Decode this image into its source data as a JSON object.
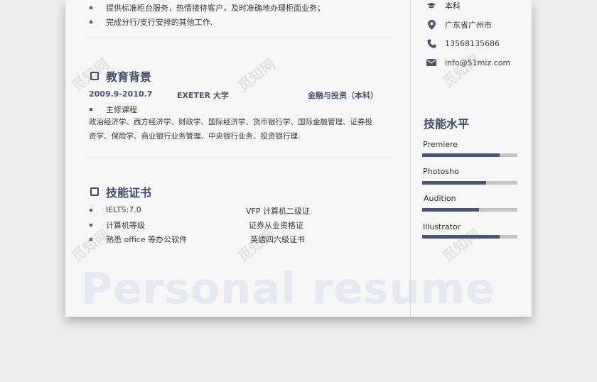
{
  "work": {
    "bullets": [
      "提供标准柜台服务，热情接待客户，及时准确地办理柜面业务；",
      "完成分行/支行安排的其他工作."
    ]
  },
  "education": {
    "title": "教育背景",
    "period": "2009.9-2010.7",
    "school": "EXETER 大学",
    "major": "金融与投资（本科）",
    "course_label": "主修课程",
    "courses_line1": "政治经济学、西方经济学、财政学、国际经济学、货币银行学、国际金融管理、证券投",
    "courses_line2": "资学、保险学、商业银行业务管理、中央银行业务、投资银行理."
  },
  "certificates": {
    "title": "技能证书",
    "left": [
      "IELTS:7.0",
      "计算机等级",
      "熟悉 office 等办公软件"
    ],
    "right": [
      "VFP 计算机二级证",
      "证券从业资格证",
      "英語四六級证书"
    ]
  },
  "watermark": "Personal resume",
  "sidebar": {
    "degree": "本科",
    "location": "广东省广州市",
    "phone": "13568135686",
    "email": "info@51miz.com",
    "skills_title": "技能水平",
    "skills": [
      {
        "name": "Premiere",
        "level": 0.81
      },
      {
        "name": "Photosho",
        "level": 0.67
      },
      {
        "name": "Audition",
        "level": 0.6
      },
      {
        "name": "Illustrator",
        "level": 0.81
      }
    ]
  },
  "stamp_text": "觅知网",
  "colors": {
    "accent": "#3f4a66",
    "bar_fill": "#4a5670",
    "bar_track": "#c4c4c4"
  }
}
